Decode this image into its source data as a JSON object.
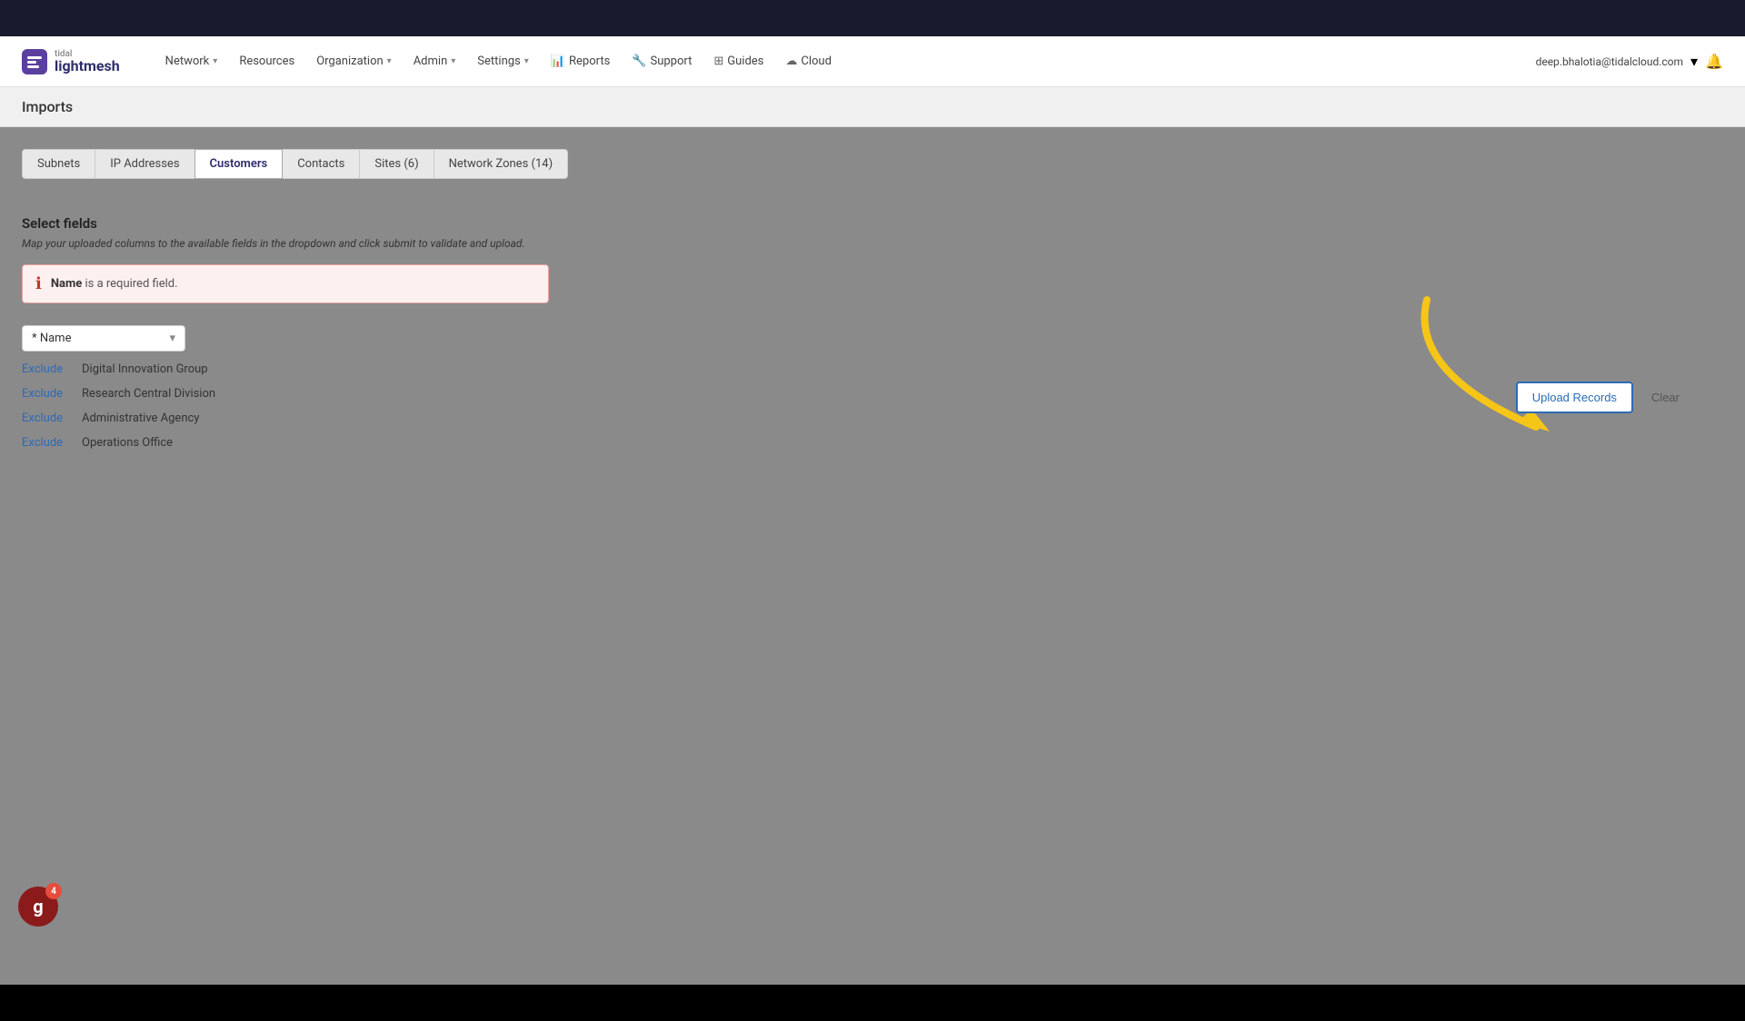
{
  "app": {
    "logo_tidal": "tidal",
    "logo_main": "lightmesh"
  },
  "navbar": {
    "links": [
      {
        "id": "network",
        "label": "Network",
        "hasChevron": true
      },
      {
        "id": "resources",
        "label": "Resources",
        "hasChevron": false
      },
      {
        "id": "organization",
        "label": "Organization",
        "hasChevron": true
      },
      {
        "id": "admin",
        "label": "Admin",
        "hasChevron": true
      },
      {
        "id": "settings",
        "label": "Settings",
        "hasChevron": true
      },
      {
        "id": "reports",
        "label": "Reports",
        "hasChevron": false,
        "icon": "bar-chart"
      },
      {
        "id": "support",
        "label": "Support",
        "hasChevron": false,
        "icon": "wrench"
      },
      {
        "id": "guides",
        "label": "Guides",
        "hasChevron": false,
        "icon": "grid"
      },
      {
        "id": "cloud",
        "label": "Cloud",
        "hasChevron": false,
        "icon": "cloud"
      }
    ],
    "user_email": "deep.bhalotia@tidalcloud.com",
    "user_chevron": "▾"
  },
  "page": {
    "title": "Imports"
  },
  "tabs": [
    {
      "id": "subnets",
      "label": "Subnets",
      "active": false
    },
    {
      "id": "ip-addresses",
      "label": "IP Addresses",
      "active": false
    },
    {
      "id": "customers",
      "label": "Customers",
      "active": true
    },
    {
      "id": "contacts",
      "label": "Contacts",
      "active": false
    },
    {
      "id": "sites",
      "label": "Sites (6)",
      "active": false
    },
    {
      "id": "network-zones",
      "label": "Network Zones (14)",
      "active": false
    }
  ],
  "select_fields": {
    "title": "Select fields",
    "subtitle": "Map your uploaded columns to the available fields in the dropdown and click submit to validate and upload.",
    "alert": {
      "text_bold": "Name",
      "text_rest": " is a required field."
    }
  },
  "field_rows": [
    {
      "id": "row1",
      "exclude_label": "Exclude",
      "dropdown_label": "* Name",
      "value": "Digital Innovation Group"
    },
    {
      "id": "row2",
      "exclude_label": "Exclude",
      "dropdown_label": "* Name",
      "value": "Research Central Division"
    },
    {
      "id": "row3",
      "exclude_label": "Exclude",
      "dropdown_label": "* Name",
      "value": "Administrative Agency"
    },
    {
      "id": "row4",
      "exclude_label": "Exclude",
      "dropdown_label": "* Name",
      "value": "Operations Office"
    }
  ],
  "buttons": {
    "upload_records": "Upload Records",
    "clear": "Clear"
  },
  "grammarly": {
    "letter": "g",
    "badge": "4"
  }
}
